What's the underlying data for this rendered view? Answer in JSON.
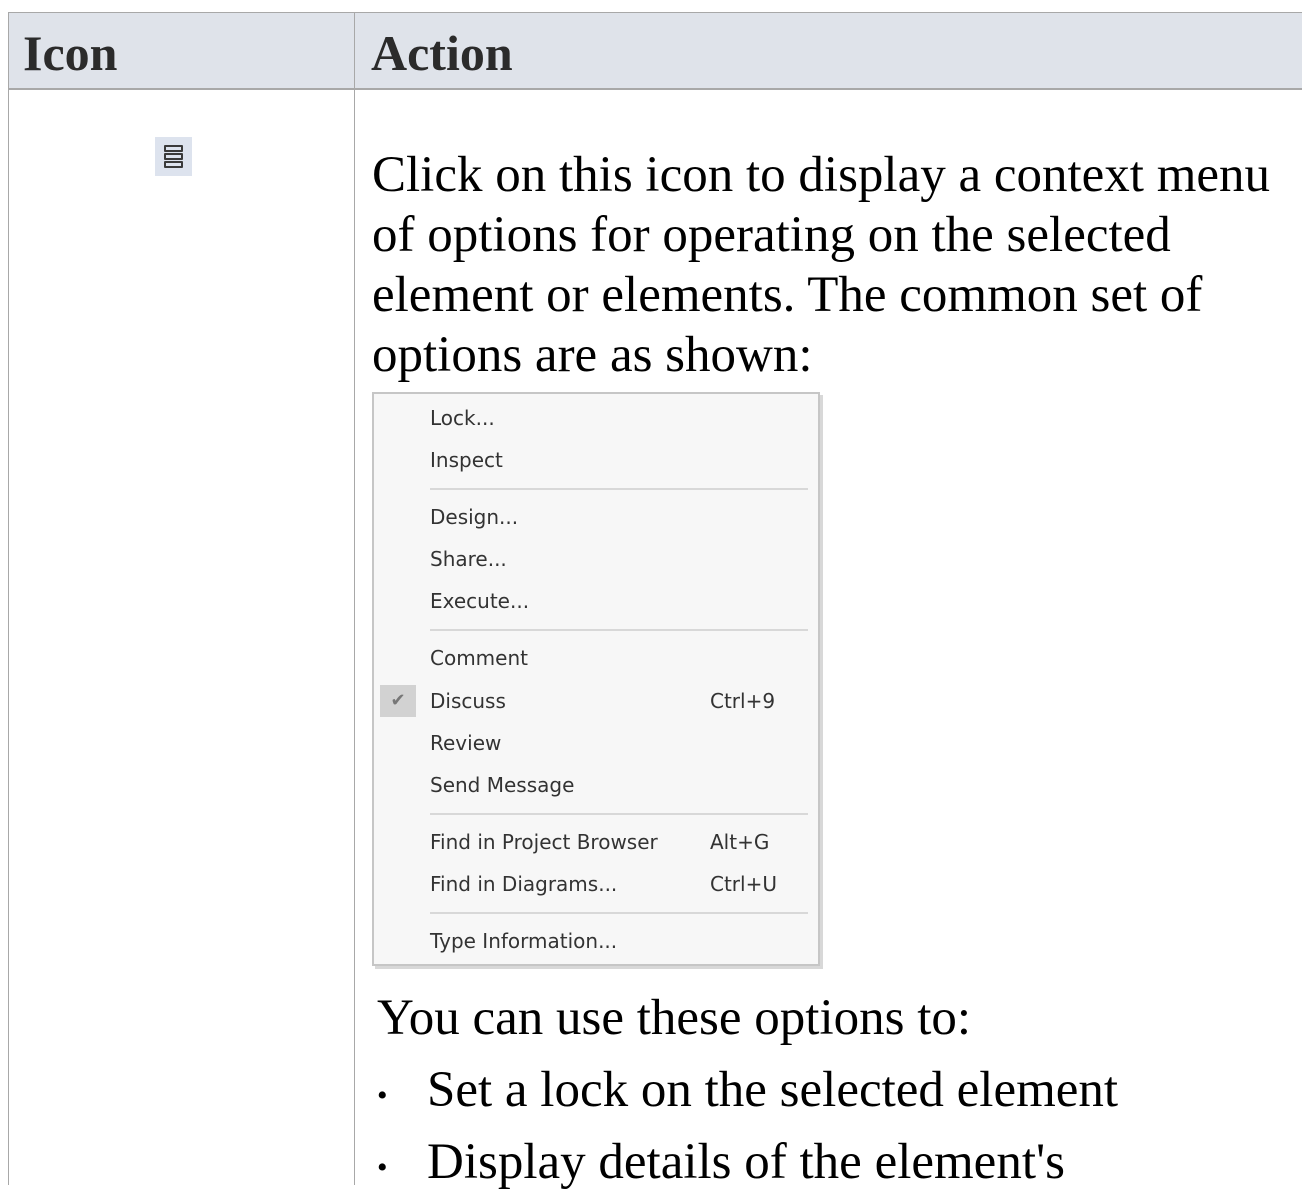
{
  "table": {
    "header": {
      "icon_col": "Icon",
      "action_col": "Action"
    }
  },
  "row": {
    "icon": "menu-icon",
    "description": "Click on this icon to display a context menu of options for operating on the selected element or elements. The common set of options are as shown:",
    "menu": {
      "items": [
        {
          "label": "Lock..."
        },
        {
          "label": "Inspect"
        },
        {
          "label": "Design..."
        },
        {
          "label": "Share..."
        },
        {
          "label": "Execute..."
        },
        {
          "label": "Comment"
        },
        {
          "label": "Discuss",
          "shortcut": "Ctrl+9",
          "checked": true
        },
        {
          "label": "Review"
        },
        {
          "label": "Send Message"
        },
        {
          "label": "Find in Project Browser",
          "shortcut": "Alt+G"
        },
        {
          "label": "Find in Diagrams...",
          "shortcut": "Ctrl+U"
        },
        {
          "label": "Type Information..."
        }
      ],
      "check_glyph": "✔"
    },
    "after_text": "You can use these options to:",
    "bullets": [
      "Set a lock on the selected element",
      "Display details of the element's"
    ],
    "bullet_glyph": "•"
  }
}
